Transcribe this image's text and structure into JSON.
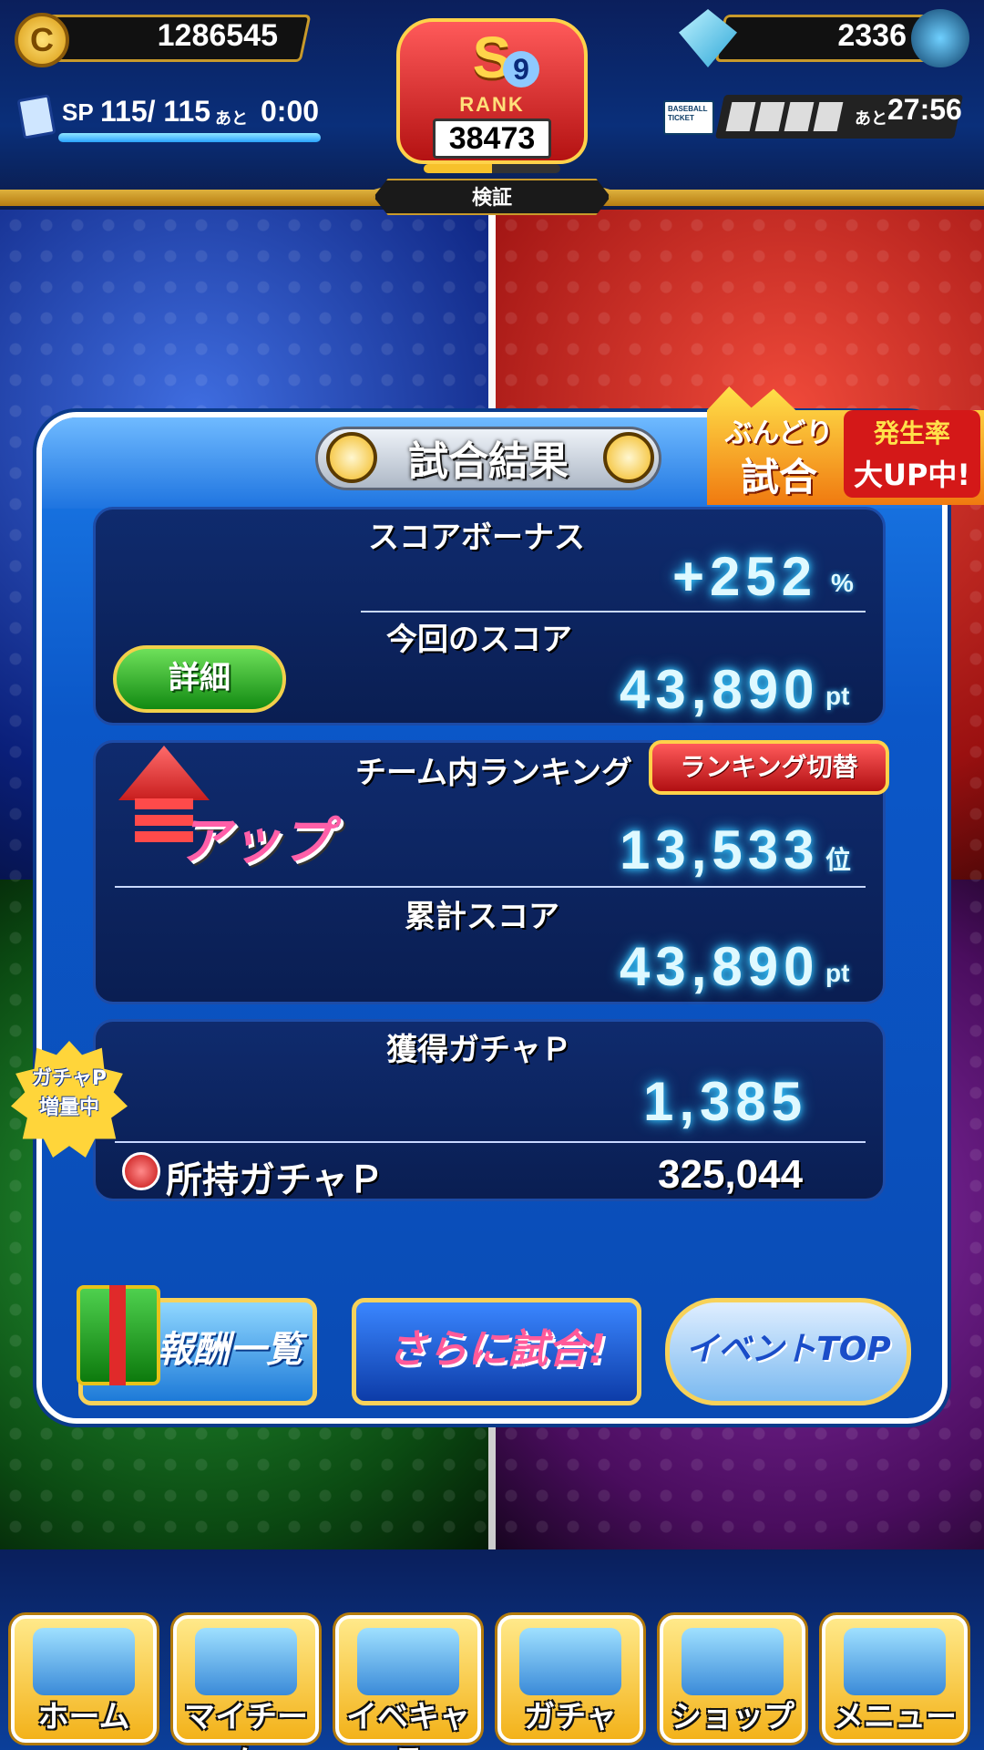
{
  "header": {
    "coins": "1286545",
    "coin_symbol": "C",
    "gems": "2336",
    "sp_label": "SP",
    "sp_value": "115/ 115",
    "sp_ato": "あと",
    "sp_time": "0:00",
    "sp_progress": 1.0,
    "rank_letter": "S",
    "rank_sub": "9",
    "rank_word": "RANK",
    "rank_points": "38473",
    "rank_progress": 0.5,
    "player_name": "検証",
    "ticket_label": "BASEBALL TICKET",
    "ticket_filled": 4,
    "ticket_total": 6,
    "ticket_ato": "あと",
    "ticket_time": "27:56"
  },
  "promo": {
    "line1": "ぶんどり",
    "line2": "試合",
    "line3": "発生率",
    "line4": "大UP中!"
  },
  "panel": {
    "title": "試合結果",
    "score_bonus_label": "スコアボーナス",
    "score_bonus_value": "+252",
    "score_bonus_unit": "%",
    "current_score_label": "今回のスコア",
    "current_score_value": "43,890",
    "current_score_unit": "pt",
    "detail_button": "詳細",
    "team_ranking_label": "チーム内ランキング",
    "ranking_switch_button": "ランキング切替",
    "rank_up_text": "アップ",
    "team_rank_value": "13,533",
    "team_rank_unit": "位",
    "total_score_label": "累計スコア",
    "total_score_value": "43,890",
    "total_score_unit": "pt",
    "gacha_earned_label": "獲得ガチャＰ",
    "gacha_earned_value": "1,385",
    "gacha_badge_line1": "ガチャP",
    "gacha_badge_line2": "増量中",
    "gacha_owned_label": "所持ガチャＰ",
    "gacha_owned_value": "325,044"
  },
  "actions": {
    "reward_list": "報酬一覧",
    "play_more": "さらに試合!",
    "event_top": "イベントTOP"
  },
  "nav": {
    "items": [
      {
        "label": "ホーム"
      },
      {
        "label": "マイチーム"
      },
      {
        "label": "イベキャラ"
      },
      {
        "label": "ガチャ"
      },
      {
        "label": "ショップ"
      },
      {
        "label": "メニュー"
      }
    ]
  }
}
